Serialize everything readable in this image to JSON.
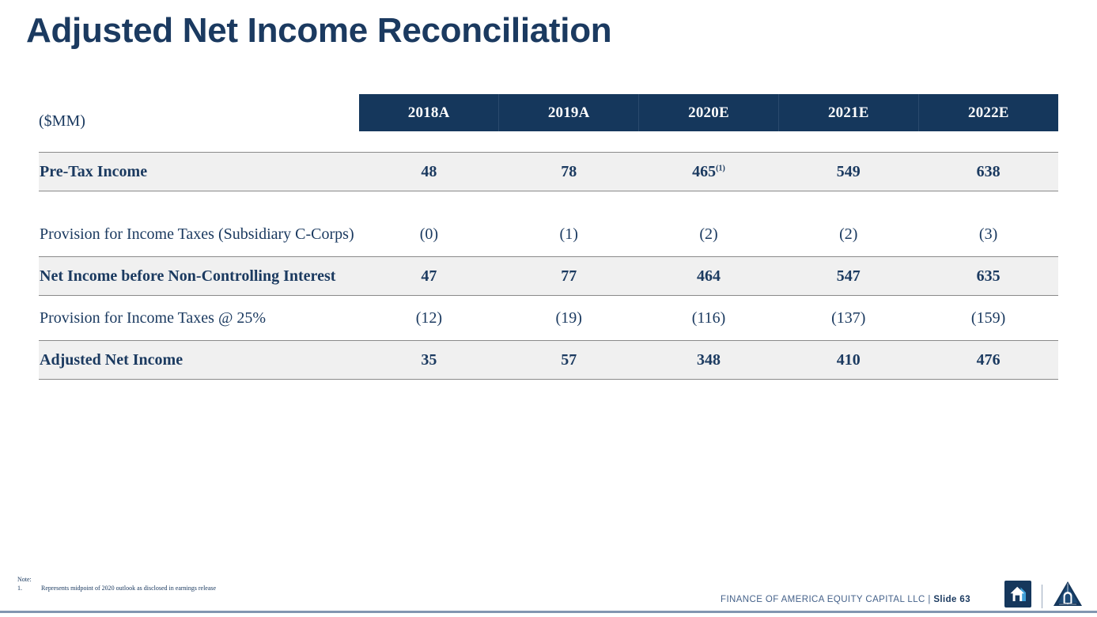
{
  "slide": {
    "title": "Adjusted Net Income Reconciliation",
    "unit_label": "($MM)"
  },
  "table": {
    "columns": [
      "2018A",
      "2019A",
      "2020E",
      "2021E",
      "2022E"
    ],
    "rows": [
      {
        "label": "Pre-Tax Income",
        "style": "bold-shaded",
        "values": [
          "48",
          "78",
          "465",
          "549",
          "638"
        ],
        "footnote_on": 2,
        "footnote_marker": "(1)"
      },
      {
        "label": "Provision for Income Taxes (Subsidiary C-Corps)",
        "style": "plain",
        "values": [
          "(0)",
          "(1)",
          "(2)",
          "(2)",
          "(3)"
        ]
      },
      {
        "label": "Net Income before Non-Controlling Interest",
        "style": "bold-shaded",
        "values": [
          "47",
          "77",
          "464",
          "547",
          "635"
        ]
      },
      {
        "label": "Provision for Income Taxes @ 25%",
        "style": "plain",
        "values": [
          "(12)",
          "(19)",
          "(116)",
          "(137)",
          "(159)"
        ]
      },
      {
        "label": "Adjusted Net Income",
        "style": "bold-shaded",
        "values": [
          "35",
          "57",
          "348",
          "410",
          "476"
        ]
      }
    ]
  },
  "notes": {
    "heading": "Note:",
    "items": [
      {
        "num": "1.",
        "text": "Represents midpoint of 2020 outlook as disclosed in earnings release"
      }
    ]
  },
  "footer": {
    "company": "FINANCE OF AMERICA EQUITY CAPITAL LLC",
    "separator": "|",
    "slide_label": "Slide 63",
    "logo_primary": "finance-of-america-house-logo",
    "logo_secondary": "replay-acquisition-lighthouse-logo"
  },
  "colors": {
    "navy": "#15375c",
    "text_navy": "#1b3a60",
    "band": "#f0f0f0",
    "rule": "#8a8a8a",
    "footer_rule": "#8296b0",
    "logo_accent": "#3d9fd8"
  }
}
